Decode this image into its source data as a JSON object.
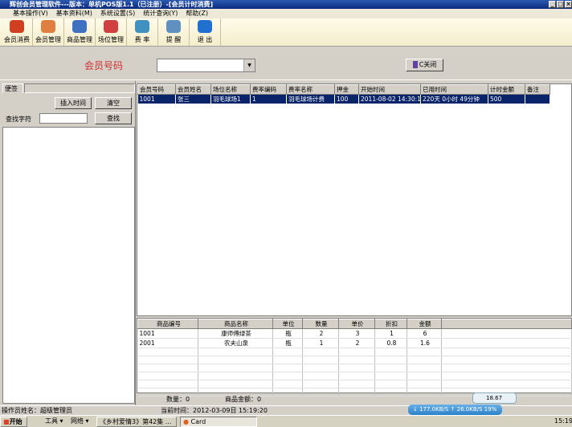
{
  "window": {
    "title": "辉创会员管理软件---版本：单机POS版1.1（已注册）-[会员计时消费]"
  },
  "menu": [
    "基本操作(V)",
    "基本资料(M)",
    "系统设置(S)",
    "统计查询(Y)",
    "帮助(Z)"
  ],
  "toolbar": [
    {
      "label": "会员消费",
      "color": "#d04020"
    },
    {
      "label": "会员管理",
      "color": "#e08040"
    },
    {
      "label": "商品管理",
      "color": "#4070c0"
    },
    {
      "label": "场位管理",
      "color": "#d04040"
    },
    {
      "label": "费 率",
      "color": "#4090c0"
    },
    {
      "label": "提 醒",
      "color": "#6090c0"
    },
    {
      "label": "退 出",
      "color": "#2070d0"
    }
  ],
  "top": {
    "member_label": "会员号码",
    "member_value": "",
    "close_label": "C关闭"
  },
  "left": {
    "tab": "便签",
    "insert_time": "插入时间",
    "clear": "清空",
    "find_label": "查找字符",
    "find_value": "",
    "find": "查找"
  },
  "grid1": {
    "columns": [
      "会员号码",
      "会员姓名",
      "场位名称",
      "费率编码",
      "费率名称",
      "押金",
      "开始时间",
      "已用时间",
      "计时金额",
      "备注"
    ],
    "rows": [
      [
        "1001",
        "张三",
        "羽毛球场1",
        "1",
        "羽毛球场计费",
        "100",
        "2011-08-02 14:30:16",
        "220天 0小时 49分钟",
        "500",
        ""
      ]
    ]
  },
  "grid2": {
    "columns": [
      "商品编号",
      "商品名称",
      "单位",
      "数量",
      "单价",
      "折扣",
      "金额"
    ],
    "rows": [
      [
        "1001",
        "康师傅绿茶",
        "瓶",
        "2",
        "3",
        "1",
        "6"
      ],
      [
        "2001",
        "农夫山泉",
        "瓶",
        "1",
        "2",
        "0.8",
        "1.6"
      ]
    ]
  },
  "totals": {
    "qty": "数量：0",
    "amount": "商品金额：0"
  },
  "status": {
    "operator": "操作员姓名：超级管理员",
    "time": "当前时间：2012-03-09日 15:19:20"
  },
  "taskbar": {
    "start": "开始",
    "tools": "工具 ▾",
    "network": "网络 ▾",
    "task1": "《乡村爱情3》第42集 ...",
    "task2": "Card",
    "clock": "15:19"
  },
  "net": {
    "down": "177.0KB/S",
    "up": "26.0KB/S",
    "pct": "19%",
    "speed": "18.67 KB/s"
  }
}
